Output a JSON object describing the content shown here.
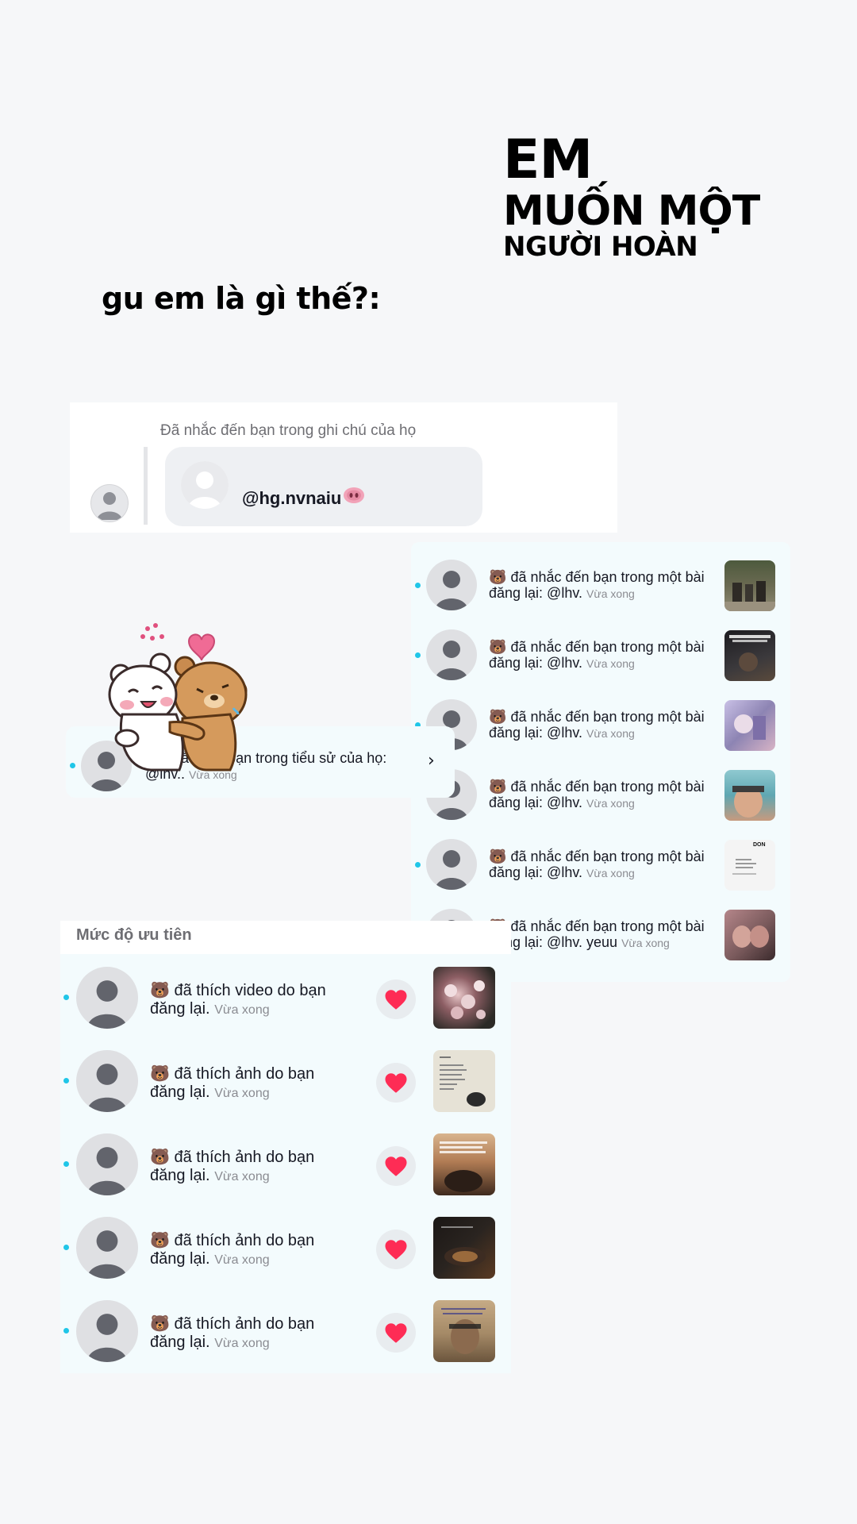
{
  "headline": {
    "line1": "EM",
    "line2": "MUỐN MỘT",
    "line3": "NGƯỜI HOÀN"
  },
  "question": "gu em là gì thế?:",
  "note_card": {
    "caption": "Đã nhắc đến bạn trong ghi chú của họ",
    "handle": "@hg.nvnaiu",
    "handle_emoji": "pig-nose-icon"
  },
  "repost_card": {
    "rows": [
      {
        "emoji": "🐻",
        "text": "đã nhắc đến bạn trong một bài đăng lại: @lhv.",
        "time": "Vừa xong",
        "thumb_color": "#6b6a52"
      },
      {
        "emoji": "🐻",
        "text": "đã nhắc đến bạn trong một bài đăng lại: @lhv.",
        "time": "Vừa xong",
        "thumb_color": "#2d2c2e"
      },
      {
        "emoji": "🐻",
        "text": "đã nhắc đến bạn trong một bài đăng lại: @lhv.",
        "time": "Vừa xong",
        "thumb_color": "#8d84b3"
      },
      {
        "emoji": "🐻",
        "text": "đã nhắc đến bạn trong một bài đăng lại: @lhv.",
        "time": "Vừa xong",
        "thumb_color": "#5fa7b2"
      },
      {
        "emoji": "🐻",
        "text": "đã nhắc đến bạn trong một bài đăng lại: @lhv.",
        "time": "Vừa xong",
        "thumb_color": "#f2f2f2",
        "thumb_text": "DON"
      },
      {
        "emoji": "🐻",
        "text": "đã nhắc đến bạn trong một bài đăng lại: @lhv. yeuu",
        "time": "Vừa xong",
        "thumb_color": "#7a5a5c"
      }
    ]
  },
  "bio_card": {
    "text": "đã nhắc đến bạn trong tiểu sử của họ: @lhv..",
    "time": "Vừa xong"
  },
  "likes_card": {
    "header": "Mức độ ưu tiên",
    "rows": [
      {
        "emoji": "🐻",
        "text": "đã thích video do bạn đăng lại.",
        "time": "Vừa xong",
        "thumb_color": "#4d3a3e"
      },
      {
        "emoji": "🐻",
        "text": "đã thích ảnh do bạn đăng lại.",
        "time": "Vừa xong",
        "thumb_color": "#e6e2d6"
      },
      {
        "emoji": "🐻",
        "text": "đã thích ảnh do bạn đăng lại.",
        "time": "Vừa xong",
        "thumb_color": "#b27d55"
      },
      {
        "emoji": "🐻",
        "text": "đã thích ảnh do bạn đăng lại.",
        "time": "Vừa xong",
        "thumb_color": "#2a2420"
      },
      {
        "emoji": "🐻",
        "text": "đã thích ảnh do bạn đăng lại.",
        "time": "Vừa xong",
        "thumb_color": "#a48966"
      }
    ]
  },
  "colors": {
    "unread_dot": "#1fc6e8",
    "heart": "#fe2c55",
    "card_bg": "#f3fbfd"
  }
}
